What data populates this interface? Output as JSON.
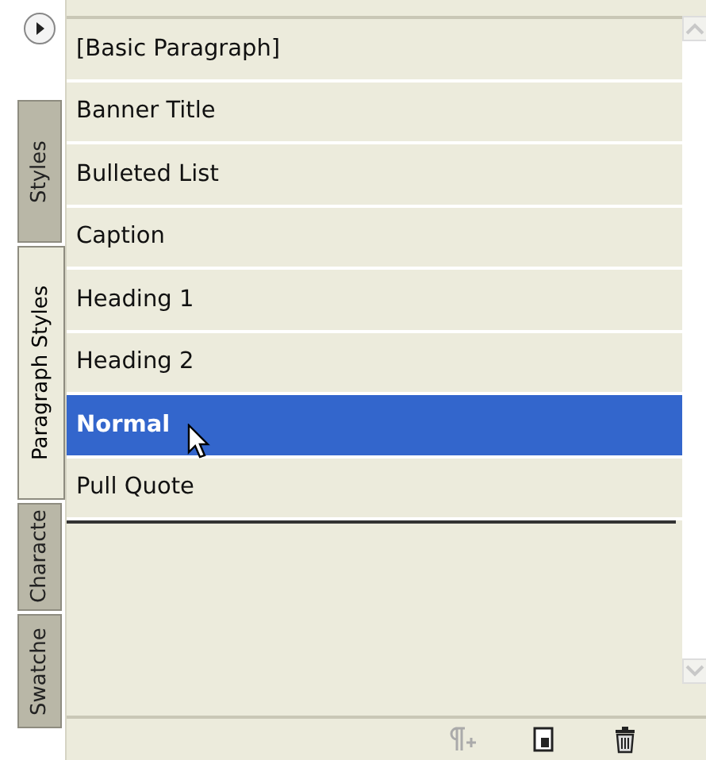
{
  "tabs": [
    {
      "label": "Styles",
      "selected": false
    },
    {
      "label": "Paragraph Styles",
      "selected": true
    },
    {
      "label": "Characte",
      "selected": false
    },
    {
      "label": "Swatche",
      "selected": false
    }
  ],
  "styles": [
    {
      "name": "[Basic Paragraph]",
      "selected": false
    },
    {
      "name": "Banner Title",
      "selected": false
    },
    {
      "name": "Bulleted List",
      "selected": false
    },
    {
      "name": "Caption",
      "selected": false
    },
    {
      "name": "Heading 1",
      "selected": false
    },
    {
      "name": "Heading 2",
      "selected": false
    },
    {
      "name": "Normal",
      "selected": true
    },
    {
      "name": "Pull Quote",
      "selected": false
    }
  ],
  "footer_buttons": [
    {
      "kind": "pilcrow",
      "disabled": true
    },
    {
      "kind": "new",
      "disabled": false
    },
    {
      "kind": "trash",
      "disabled": false
    }
  ]
}
